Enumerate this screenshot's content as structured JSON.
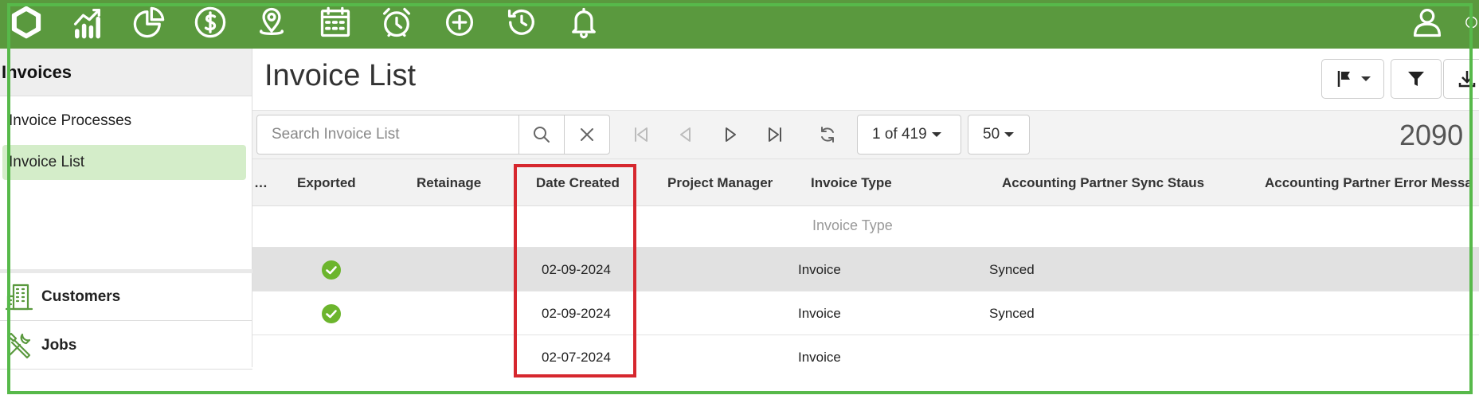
{
  "nav": {
    "icons": [
      "logo-hexagon-icon",
      "analytics-icon",
      "pie-chart-icon",
      "dollar-icon",
      "location-pin-icon",
      "calendar-icon",
      "alarm-clock-icon",
      "add-circle-icon",
      "history-icon",
      "bell-icon",
      "user-icon"
    ]
  },
  "sidebar": {
    "section_title": "Invoices",
    "items": [
      {
        "label": "Invoice Processes",
        "active": false
      },
      {
        "label": "Invoice List",
        "active": true
      }
    ],
    "nav": [
      {
        "label": "Customers",
        "icon": "building-icon"
      },
      {
        "label": "Jobs",
        "icon": "tools-icon"
      }
    ]
  },
  "main": {
    "title": "Invoice List",
    "header_buttons": [
      "flag-dropdown-icon",
      "filter-icon",
      "download-icon"
    ]
  },
  "toolbar": {
    "search_placeholder": "Search Invoice List",
    "page_indicator": "1 of 419",
    "page_size": "50",
    "total_count": "2090"
  },
  "table": {
    "truncated_col": "…",
    "columns": [
      "Exported",
      "Retainage",
      "Date Created",
      "Project Manager",
      "Invoice Type",
      "Accounting Partner Sync Staus",
      "Accounting Partner Error Messa"
    ],
    "filter_placeholder": "Invoice Type",
    "rows": [
      {
        "exported": true,
        "retainage": "",
        "date_created": "02-09-2024",
        "project_manager": "",
        "invoice_type": "Invoice",
        "sync_status": "Synced",
        "error_message": ""
      },
      {
        "exported": true,
        "retainage": "",
        "date_created": "02-09-2024",
        "project_manager": "",
        "invoice_type": "Invoice",
        "sync_status": "Synced",
        "error_message": ""
      },
      {
        "exported": false,
        "retainage": "",
        "date_created": "02-07-2024",
        "project_manager": "",
        "invoice_type": "Invoice",
        "sync_status": "",
        "error_message": ""
      }
    ]
  },
  "colors": {
    "nav_bg": "#5a993e",
    "active_item_bg": "#d4edc9",
    "highlight_red": "#d6272e",
    "frame_green": "#57b94a",
    "check_green": "#6cb52d"
  }
}
